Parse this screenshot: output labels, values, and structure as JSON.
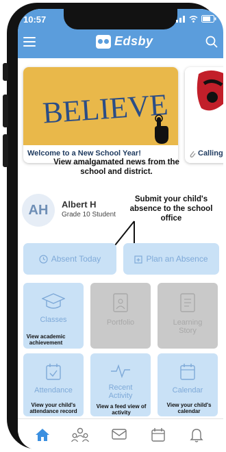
{
  "status": {
    "time": "10:57"
  },
  "header": {
    "app_name": "Edsby"
  },
  "news": [
    {
      "image_text": "BELIEVE",
      "title": "Welcome to a New School Year!"
    },
    {
      "title": "Calling"
    }
  ],
  "annotations": {
    "news": "View amalgamated news from the school and district.",
    "absence": "Submit your child's absence to the school office",
    "classes": "View academic achievement",
    "attendance": "View your child's attendance record",
    "recent": "View a feed view of activity",
    "calendar": "View your child's calendar"
  },
  "student": {
    "initials": "AH",
    "name": "Albert H",
    "grade": "Grade 10 Student"
  },
  "actions": {
    "absent": "Absent Today",
    "plan": "Plan an Absence"
  },
  "tiles": {
    "classes": "Classes",
    "portfolio": "Portfolio",
    "learning": "Learning Story",
    "attendance": "Attendance",
    "recent": "Recent Activity",
    "calendar": "Calendar"
  },
  "colors": {
    "app_bar": "#5b9ddc",
    "tile_blue": "#c9e1f6",
    "tile_disabled": "#c9c9c9",
    "nav_active": "#3a8fe0"
  },
  "icons": [
    "hamburger-icon",
    "search-icon",
    "clock-icon",
    "calendar-plus-icon",
    "graduation-cap-icon",
    "portfolio-icon",
    "book-icon",
    "calendar-check-icon",
    "pulse-icon",
    "calendar-icon",
    "home-icon",
    "people-icon",
    "mail-icon",
    "bell-icon"
  ]
}
